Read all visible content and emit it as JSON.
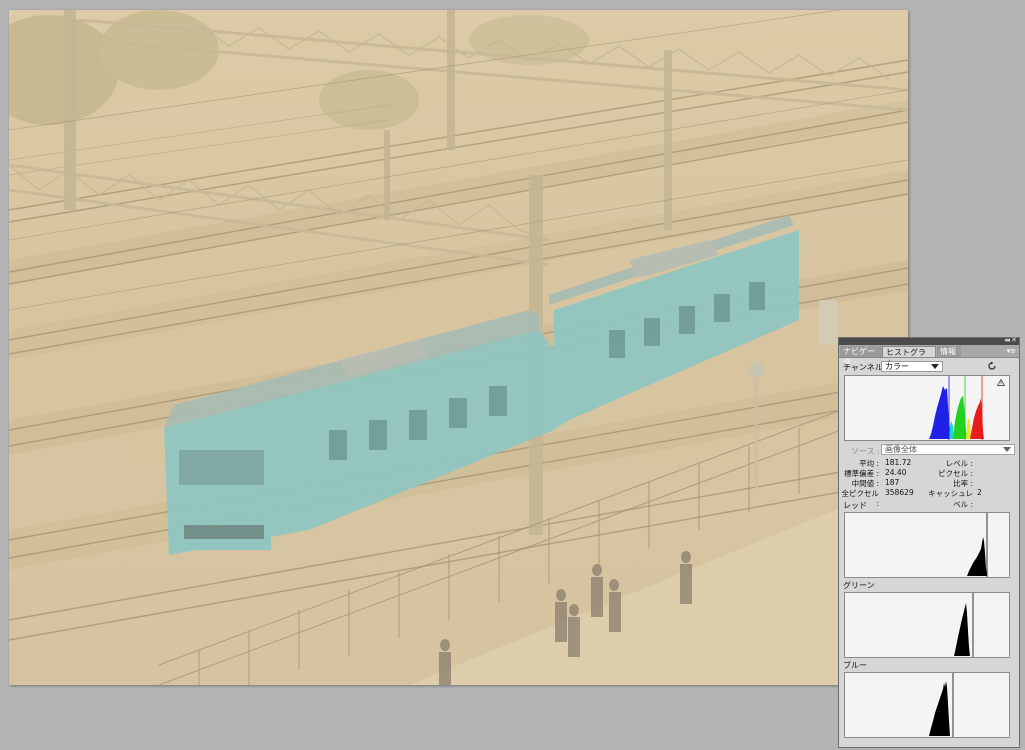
{
  "panel": {
    "tabs": [
      "ナビゲータ",
      "ヒストグラム",
      "情報"
    ],
    "channel_label": "チャンネル：",
    "channel_value": "カラー",
    "source_label": "ソース :",
    "source_value": "画像全体",
    "stats_left": [
      {
        "label": "平均 :",
        "value": "181.72"
      },
      {
        "label": "標準偏差 :",
        "value": "24.40"
      },
      {
        "label": "中間値 :",
        "value": "187"
      },
      {
        "label": "全ピクセル :",
        "value": "358629"
      }
    ],
    "stats_right": [
      {
        "label": "レベル :",
        "value": ""
      },
      {
        "label": "ピクセル :",
        "value": ""
      },
      {
        "label": "比率 :",
        "value": ""
      },
      {
        "label": "キャッシュレベル :",
        "value": "2"
      }
    ],
    "channels": [
      "レッド",
      "グリーン",
      "ブルー"
    ],
    "colors": {
      "red": "#e81c1c",
      "green": "#22d21e",
      "blue": "#2020e8",
      "yellow": "#e8e81c",
      "cyan": "#22d2d2"
    }
  }
}
